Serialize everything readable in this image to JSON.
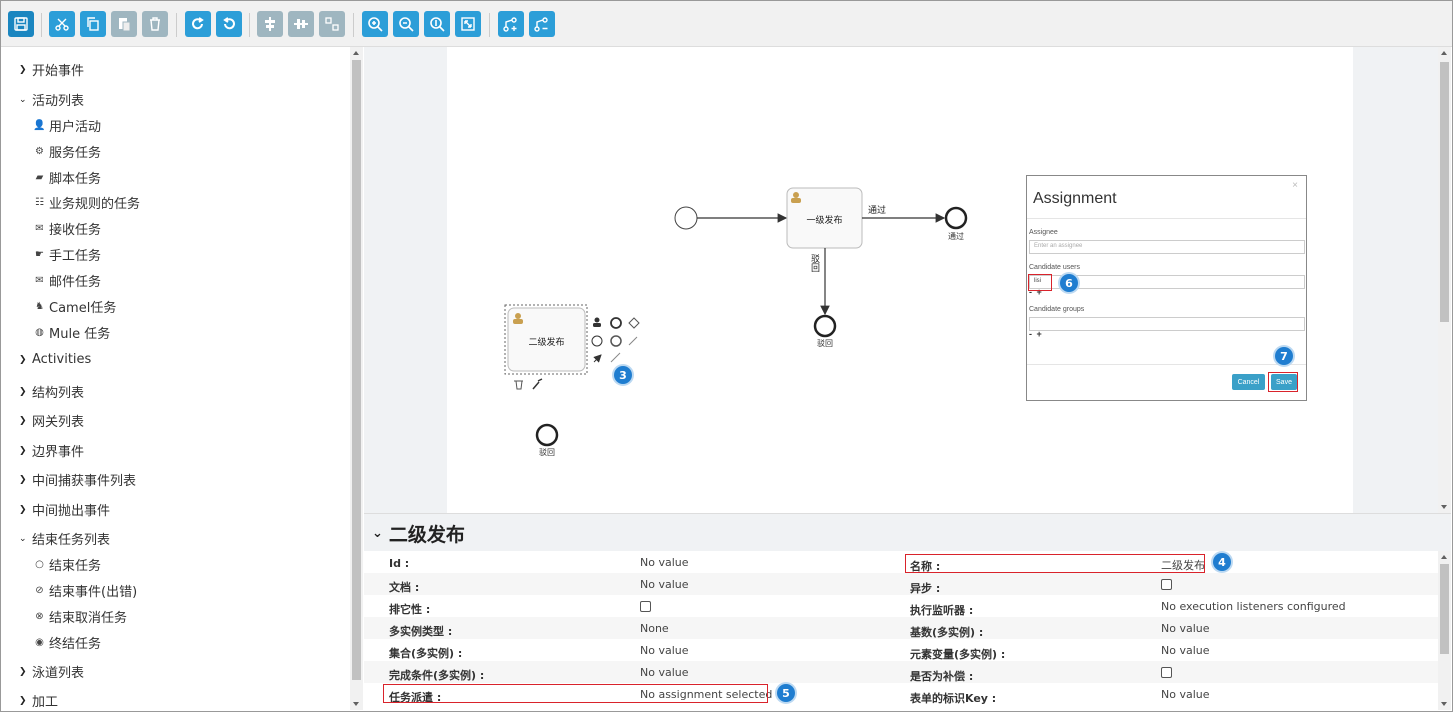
{
  "toolbar": {
    "buttons": [
      "save-icon",
      "cut-icon",
      "copy-icon",
      "paste-icon",
      "delete-icon",
      "redo-icon",
      "undo-icon",
      "align-horizontal-icon",
      "align-vertical-icon",
      "same-size-icon",
      "zoom-in-icon",
      "zoom-out-icon",
      "zoom-actual-icon",
      "zoom-fit-icon",
      "bend-add-icon",
      "bend-remove-icon"
    ]
  },
  "sidebar": {
    "categories": [
      {
        "label": "开始事件",
        "expanded": false
      },
      {
        "label": "活动列表",
        "expanded": true,
        "items": [
          {
            "label": "用户活动",
            "icon": "user-icon"
          },
          {
            "label": "服务任务",
            "icon": "gear-icon"
          },
          {
            "label": "脚本任务",
            "icon": "script-icon"
          },
          {
            "label": "业务规则的任务",
            "icon": "table-icon"
          },
          {
            "label": "接收任务",
            "icon": "envelope-open-icon"
          },
          {
            "label": "手工任务",
            "icon": "hand-icon"
          },
          {
            "label": "邮件任务",
            "icon": "envelope-icon"
          },
          {
            "label": "Camel任务",
            "icon": "camel-icon"
          },
          {
            "label": "Mule 任务",
            "icon": "mule-icon"
          }
        ]
      },
      {
        "label": "Activities",
        "expanded": false
      },
      {
        "label": "结构列表",
        "expanded": false
      },
      {
        "label": "网关列表",
        "expanded": false
      },
      {
        "label": "边界事件",
        "expanded": false
      },
      {
        "label": "中间捕获事件列表",
        "expanded": false
      },
      {
        "label": "中间抛出事件",
        "expanded": false
      },
      {
        "label": "结束任务列表",
        "expanded": true,
        "items": [
          {
            "label": "结束任务",
            "icon": "circle-icon"
          },
          {
            "label": "结束事件(出错)",
            "icon": "error-icon"
          },
          {
            "label": "结束取消任务",
            "icon": "cancel-icon"
          },
          {
            "label": "终结任务",
            "icon": "terminate-icon"
          }
        ]
      },
      {
        "label": "泳道列表",
        "expanded": false
      },
      {
        "label": "加工",
        "expanded": false
      }
    ]
  },
  "diagram": {
    "task_main": "一级发布",
    "flow_pass": "通过",
    "end_pass": "通过",
    "flow_reject": "驳回",
    "end_reject": "驳回",
    "task_selected": "二级发布",
    "end_reject2": "驳回"
  },
  "dialog": {
    "title": "Assignment",
    "close": "×",
    "assignee_label": "Assignee",
    "assignee_placeholder": "Enter an assignee",
    "candidate_users_label": "Candidate users",
    "candidate_user_value": "lisi",
    "plus_minus": "- +",
    "candidate_groups_label": "Candidate groups",
    "cancel": "Cancel",
    "save": "Save"
  },
  "properties": {
    "title": "二级发布",
    "left": [
      {
        "label": "Id :",
        "value": "No value"
      },
      {
        "label": "文档 :",
        "value": "No value"
      },
      {
        "label": "排它性 :",
        "value": "",
        "checkbox": true
      },
      {
        "label": "多实例类型 :",
        "value": "None"
      },
      {
        "label": "集合(多实例) :",
        "value": "No value"
      },
      {
        "label": "完成条件(多实例) :",
        "value": "No value"
      },
      {
        "label": "任务派遣 :",
        "value": "No assignment selected"
      }
    ],
    "right": [
      {
        "label": "名称 :",
        "value": "二级发布"
      },
      {
        "label": "异步 :",
        "value": "",
        "checkbox": true
      },
      {
        "label": "执行监听器 :",
        "value": "No execution listeners configured"
      },
      {
        "label": "基数(多实例) :",
        "value": "No value"
      },
      {
        "label": "元素变量(多实例) :",
        "value": "No value"
      },
      {
        "label": "是否为补偿 :",
        "value": "",
        "checkbox": true
      },
      {
        "label": "表单的标识Key :",
        "value": "No value"
      }
    ]
  },
  "badges": [
    "3",
    "4",
    "5",
    "6",
    "7"
  ],
  "colors": {
    "accent": "#2c9ed8",
    "annotation": "#d9232b",
    "badge": "#1f7dd0"
  }
}
